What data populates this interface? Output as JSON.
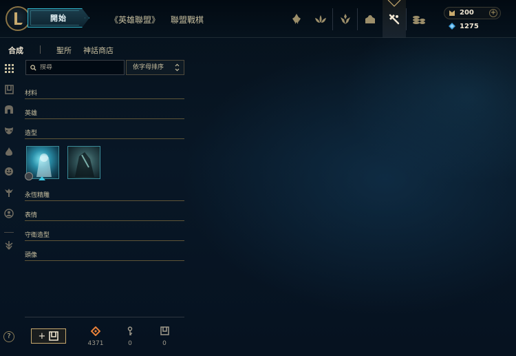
{
  "topbar": {
    "play_label": "開始",
    "nav_links": [
      "《英雄聯盟》",
      "聯盟戰棋"
    ],
    "nav_icons": [
      "home-crest-icon",
      "lotus-icon",
      "ranked-emblem-icon",
      "collection-icon",
      "loot-hammer-icon",
      "store-coins-icon"
    ],
    "active_icon": "loot-hammer-icon"
  },
  "currency": {
    "rp": "200",
    "blue_essence": "1275"
  },
  "subtabs": [
    "合成",
    "聖所",
    "神話商店"
  ],
  "search": {
    "placeholder": "搜尋"
  },
  "sort": {
    "selected": "依字母排序"
  },
  "sidebar_icons": [
    "grid-icon",
    "chest-icon",
    "helmet-icon",
    "mask-icon",
    "flame-icon",
    "emote-face-icon",
    "ward-icon",
    "profile-icon",
    "arrow-icon"
  ],
  "categories": [
    "材料",
    "英雄",
    "造型",
    "永恆精雕",
    "表情",
    "守衛造型",
    "頭像"
  ],
  "skins": [
    {
      "name": "skin-shard-1"
    },
    {
      "name": "skin-shard-2"
    }
  ],
  "resources": {
    "orange_essence": "4371",
    "keys": "0",
    "chests": "0"
  },
  "colors": {
    "gold": "#c8aa6e",
    "teal": "#2fb3c9",
    "background": "#050d16"
  }
}
